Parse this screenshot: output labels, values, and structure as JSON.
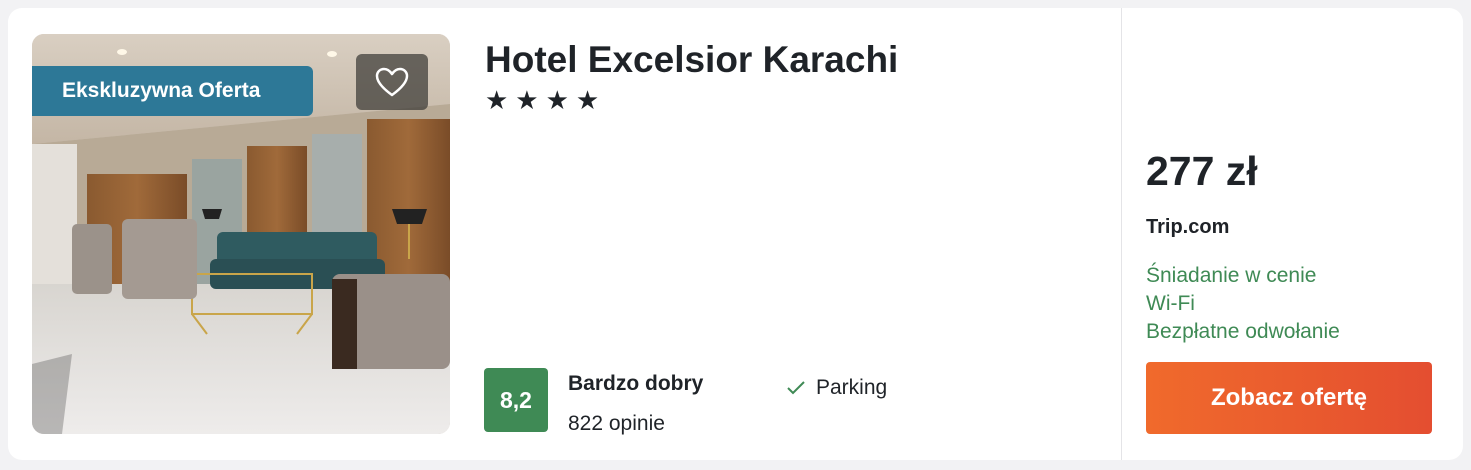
{
  "hotel": {
    "name": "Hotel Excelsior Karachi",
    "stars_display": "★★★★",
    "star_rating": 4,
    "badge": "Ekskluzywna Oferta",
    "photo_icon": "hotel-lobby-photo",
    "favorite_icon": "heart-outline-icon"
  },
  "rating": {
    "score": "8,2",
    "label": "Bardzo dobry",
    "reviews": "822 opinie",
    "color": "#3f8a55"
  },
  "amenities": [
    {
      "label": "Parking",
      "icon": "check-icon"
    }
  ],
  "offer": {
    "price": "277 zł",
    "provider": "Trip.com",
    "features": [
      "Śniadanie w cenie",
      "Wi-Fi",
      "Bezpłatne odwołanie"
    ],
    "feature_color": "#3f8a55",
    "cta_label": "Zobacz ofertę",
    "cta_color": "#e95a2e"
  },
  "colors": {
    "badge_bg": "#2d7897",
    "text": "#1f2328"
  }
}
